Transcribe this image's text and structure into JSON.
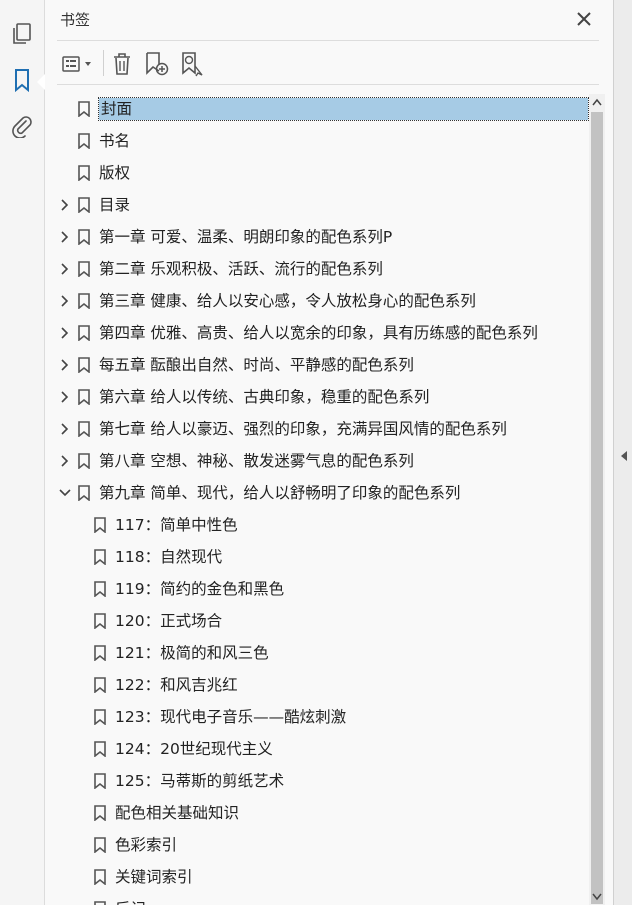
{
  "panel": {
    "title": "书签",
    "close_icon": "close-icon"
  },
  "rail": {
    "items": [
      {
        "name": "pages",
        "icon": "pages-icon"
      },
      {
        "name": "bookmarks",
        "icon": "bookmark-icon",
        "active": true
      },
      {
        "name": "attachments",
        "icon": "paperclip-icon"
      }
    ]
  },
  "toolbar": {
    "buttons": [
      {
        "name": "options-menu",
        "icon": "list-options-icon"
      },
      {
        "name": "delete",
        "icon": "trash-icon"
      },
      {
        "name": "new-bookmark",
        "icon": "add-bookmark-icon"
      },
      {
        "name": "find-bookmark",
        "icon": "find-bookmark-icon"
      }
    ]
  },
  "colors": {
    "selection": "#a6cbe5",
    "accent": "#1f6fb2"
  },
  "bookmarks": [
    {
      "label": "封面",
      "level": 0,
      "expandable": false,
      "selected": true
    },
    {
      "label": "书名",
      "level": 0,
      "expandable": false
    },
    {
      "label": "版权",
      "level": 0,
      "expandable": false
    },
    {
      "label": "目录",
      "level": 0,
      "expandable": true,
      "expanded": false
    },
    {
      "label": "第一章  可爱、温柔、明朗印象的配色系列P",
      "level": 0,
      "expandable": true,
      "expanded": false
    },
    {
      "label": "第二章  乐观积极、活跃、流行的配色系列",
      "level": 0,
      "expandable": true,
      "expanded": false
    },
    {
      "label": "第三章  健康、给人以安心感，令人放松身心的配色系列",
      "level": 0,
      "expandable": true,
      "expanded": false
    },
    {
      "label": "第四章  优雅、高贵、给人以宽余的印象，具有历练感的配色系列",
      "level": 0,
      "expandable": true,
      "expanded": false
    },
    {
      "label": "每五章  酝酿出自然、时尚、平静感的配色系列",
      "level": 0,
      "expandable": true,
      "expanded": false
    },
    {
      "label": "第六章  给人以传统、古典印象，稳重的配色系列",
      "level": 0,
      "expandable": true,
      "expanded": false
    },
    {
      "label": "第七章  给人以豪迈、强烈的印象，充满异国风情的配色系列",
      "level": 0,
      "expandable": true,
      "expanded": false
    },
    {
      "label": "第八章  空想、神秘、散发迷雾气息的配色系列",
      "level": 0,
      "expandable": true,
      "expanded": false
    },
    {
      "label": "第九章  简单、现代，给人以舒畅明了印象的配色系列",
      "level": 0,
      "expandable": true,
      "expanded": true
    },
    {
      "label": "117：简单中性色",
      "level": 1,
      "expandable": false
    },
    {
      "label": "118：自然现代",
      "level": 1,
      "expandable": false
    },
    {
      "label": "119：简约的金色和黑色",
      "level": 1,
      "expandable": false
    },
    {
      "label": "120：正式场合",
      "level": 1,
      "expandable": false
    },
    {
      "label": "121：极简的和风三色",
      "level": 1,
      "expandable": false
    },
    {
      "label": "122：和风吉兆红",
      "level": 1,
      "expandable": false
    },
    {
      "label": "123：现代电子音乐——酷炫刺激",
      "level": 1,
      "expandable": false
    },
    {
      "label": "124：20世纪现代主义",
      "level": 1,
      "expandable": false
    },
    {
      "label": "125：马蒂斯的剪纸艺术",
      "level": 1,
      "expandable": false
    },
    {
      "label": "配色相关基础知识",
      "level": 1,
      "expandable": false
    },
    {
      "label": "色彩索引",
      "level": 1,
      "expandable": false
    },
    {
      "label": "关键词索引",
      "level": 1,
      "expandable": false
    },
    {
      "label": "后记",
      "level": 1,
      "expandable": false
    }
  ]
}
